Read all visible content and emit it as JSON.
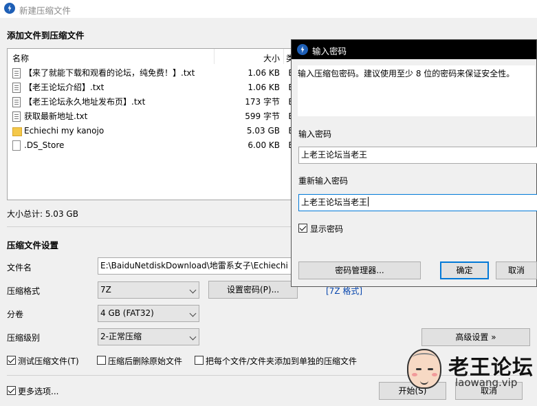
{
  "window": {
    "title": "新建压缩文件"
  },
  "add_section": {
    "title": "添加文件到压缩文件"
  },
  "file_list": {
    "columns": {
      "name": "名称",
      "size": "大小",
      "extra": "类"
    },
    "rows": [
      {
        "name": "【来了就能下载和观看的论坛，纯免费！】.txt",
        "size": "1.06 KB",
        "extra": "E",
        "icon": "text-file-icon"
      },
      {
        "name": "【老王论坛介绍】.txt",
        "size": "1.06 KB",
        "extra": "E",
        "icon": "text-file-icon"
      },
      {
        "name": "【老王论坛永久地址发布页】.txt",
        "size": "173 字节",
        "extra": "E",
        "icon": "text-file-icon"
      },
      {
        "name": "获取最新地址.txt",
        "size": "599 字节",
        "extra": "E",
        "icon": "text-file-icon"
      },
      {
        "name": "Echiechi my kanojo",
        "size": "5.03 GB",
        "extra": "E",
        "icon": "folder-icon"
      },
      {
        "name": ".DS_Store",
        "size": "6.00 KB",
        "extra": "E",
        "icon": "blank-file-icon"
      }
    ]
  },
  "total_size": "大小总计: 5.03 GB",
  "settings": {
    "title": "压缩文件设置",
    "filename_label": "文件名",
    "filename_value": "E:\\BaiduNetdiskDownload\\地雷系女子\\Echiechi m",
    "format_label": "压缩格式",
    "format_value": "7Z",
    "set_password_button": "设置密码(P)...",
    "format_link": "[7Z 格式]",
    "split_label": "分卷",
    "split_value": "4 GB (FAT32)",
    "level_label": "压缩级别",
    "level_value": "2-正常压缩",
    "advanced_button": "高级设置 »",
    "test_checkbox": "测试压缩文件(T)",
    "delete_checkbox": "压缩后删除原始文件",
    "separate_checkbox": "把每个文件/文件夹添加到单独的压缩文件",
    "more_options": "更多选项...",
    "start_button": "开始(S)",
    "cancel_button": "取消"
  },
  "password_dialog": {
    "title": "输入密码",
    "description": "输入压缩包密码。建议使用至少 8 位的密码来保证安全性。",
    "password_label": "输入密码",
    "password_value": "上老王论坛当老王",
    "confirm_label": "重新输入密码",
    "confirm_value": "上老王论坛当老王",
    "show_password": "显示密码",
    "manager_button": "密码管理器...",
    "ok_button": "确定",
    "cancel_button": "取消"
  },
  "watermark": {
    "title": "老王论坛",
    "url": "laowang.vip"
  },
  "colors": {
    "accent": "#0078d7",
    "link": "#0645ad",
    "dialog_title_bg": "#000000"
  }
}
